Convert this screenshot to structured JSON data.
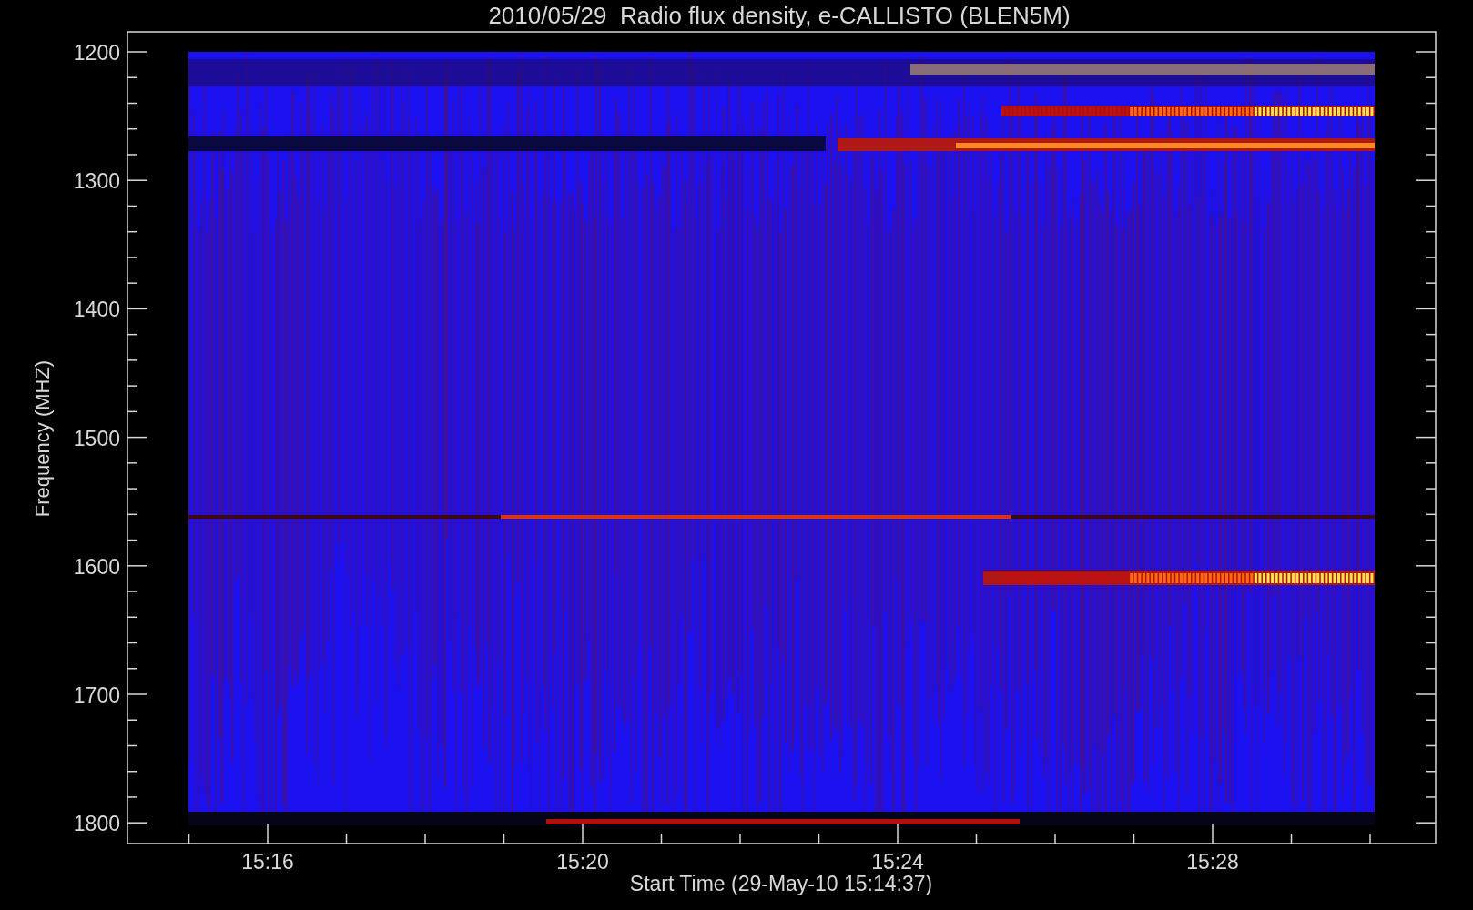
{
  "plot": {
    "title": "2010/05/29  Radio flux density, e-CALLISTO (BLEN5M)",
    "ylabel": "Frequency (MHZ)",
    "xlabel": "Start Time (29-May-10 15:14:37)",
    "yticks": [
      "1200",
      "1300",
      "1400",
      "1500",
      "1600",
      "1700",
      "1800"
    ],
    "xticks": [
      "15:16",
      "15:20",
      "15:24",
      "15:28"
    ]
  }
}
